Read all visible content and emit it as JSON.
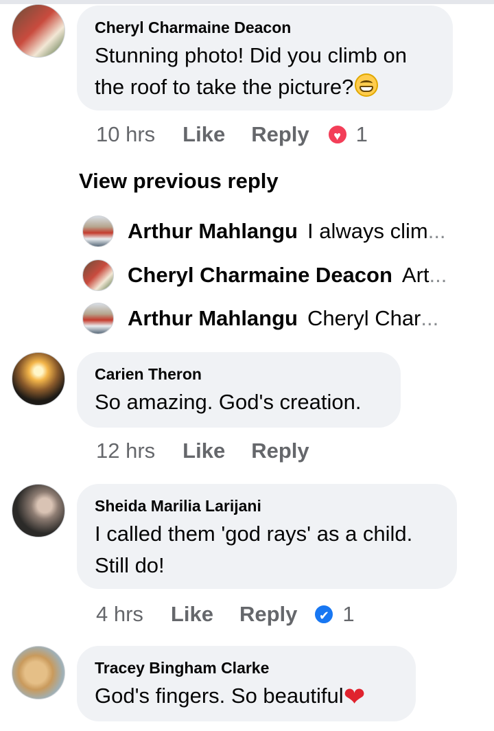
{
  "comments": [
    {
      "author": "Cheryl Charmaine Deacon",
      "text_line1": "Stunning photo! Did you climb on",
      "text_line2": "the roof to take the picture?",
      "emoji": "grinning-face",
      "time": "10 hrs",
      "like_label": "Like",
      "reply_label": "Reply",
      "reaction": "love",
      "reaction_count": "1"
    },
    {
      "author": "Carien Theron",
      "text_line1": "So amazing. God's creation.",
      "time": "12 hrs",
      "like_label": "Like",
      "reply_label": "Reply"
    },
    {
      "author": "Sheida Marilia Larijani",
      "text_line1": "I called them 'god rays' as a child.",
      "text_line2": "Still do!",
      "time": "4 hrs",
      "like_label": "Like",
      "reply_label": "Reply",
      "reaction": "like",
      "reaction_count": "1"
    },
    {
      "author": "Tracey Bingham Clarke",
      "text_line1": "God's fingers. So beautiful",
      "emoji": "red-heart"
    }
  ],
  "view_previous_label": "View previous reply",
  "replies": [
    {
      "author": "Arthur Mahlangu",
      "preview": "I always clim",
      "ellipsis": "..."
    },
    {
      "author": "Cheryl Charmaine Deacon",
      "preview": "Art",
      "ellipsis": "..."
    },
    {
      "author": "Arthur Mahlangu",
      "preview": "Cheryl Char",
      "ellipsis": "..."
    }
  ],
  "colors": {
    "bubble": "#f0f2f5",
    "meta_text": "#65676b",
    "love_reaction": "#f33e58",
    "like_reaction": "#1877f2"
  }
}
